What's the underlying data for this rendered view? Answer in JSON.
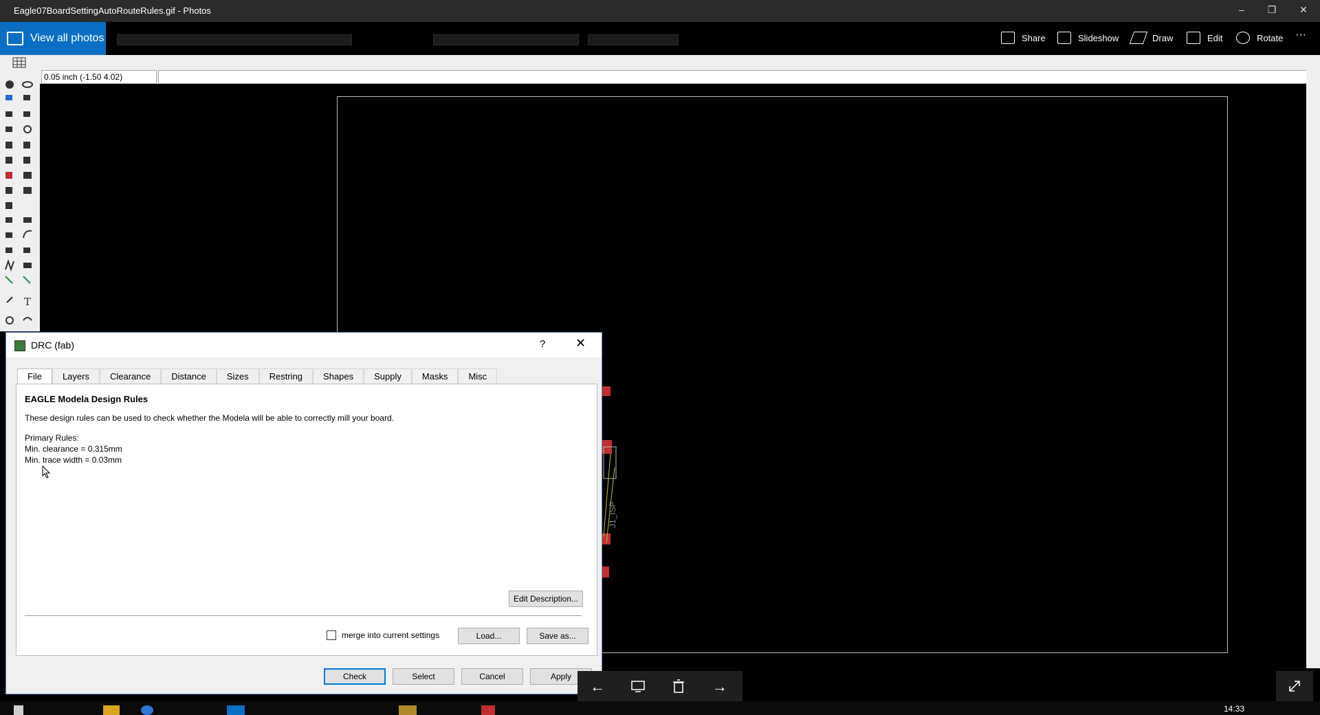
{
  "window": {
    "title": "Eagle07BoardSettingAutoRouteRules.gif - Photos",
    "minimize": "–",
    "restore": "❐",
    "close": "✕"
  },
  "photos_toolbar": {
    "view_all": "View all photos",
    "share": "Share",
    "slideshow": "Slideshow",
    "draw": "Draw",
    "edit": "Edit",
    "rotate": "Rotate",
    "more": "···"
  },
  "eagle": {
    "coordinate": "0.05 inch (-1.50 4.02)",
    "part_label": "J1_ISP"
  },
  "dialog": {
    "title": "DRC (fab)",
    "help": "?",
    "close": "✕",
    "tabs": [
      "File",
      "Layers",
      "Clearance",
      "Distance",
      "Sizes",
      "Restring",
      "Shapes",
      "Supply",
      "Masks",
      "Misc"
    ],
    "active_tab": "File",
    "heading": "EAGLE Modela Design Rules",
    "description": "These design rules can be used to check whether the Modela will be able to correctly mill your board.",
    "rules_title": "Primary Rules:",
    "rule_1": "Min. clearance = 0.315mm",
    "rule_2": "Min. trace width = 0.03mm",
    "edit_description": "Edit Description...",
    "merge_label": "merge into current settings",
    "merge_checked": false,
    "load": "Load...",
    "save_as": "Save as...",
    "check": "Check",
    "select": "Select",
    "cancel": "Cancel",
    "apply": "Apply"
  },
  "viewer_nav": {
    "prev": "←",
    "next": "→"
  },
  "taskbar": {
    "time": "14:33"
  },
  "colors": {
    "accent": "#0a6fc2",
    "pad": "#c03030"
  }
}
